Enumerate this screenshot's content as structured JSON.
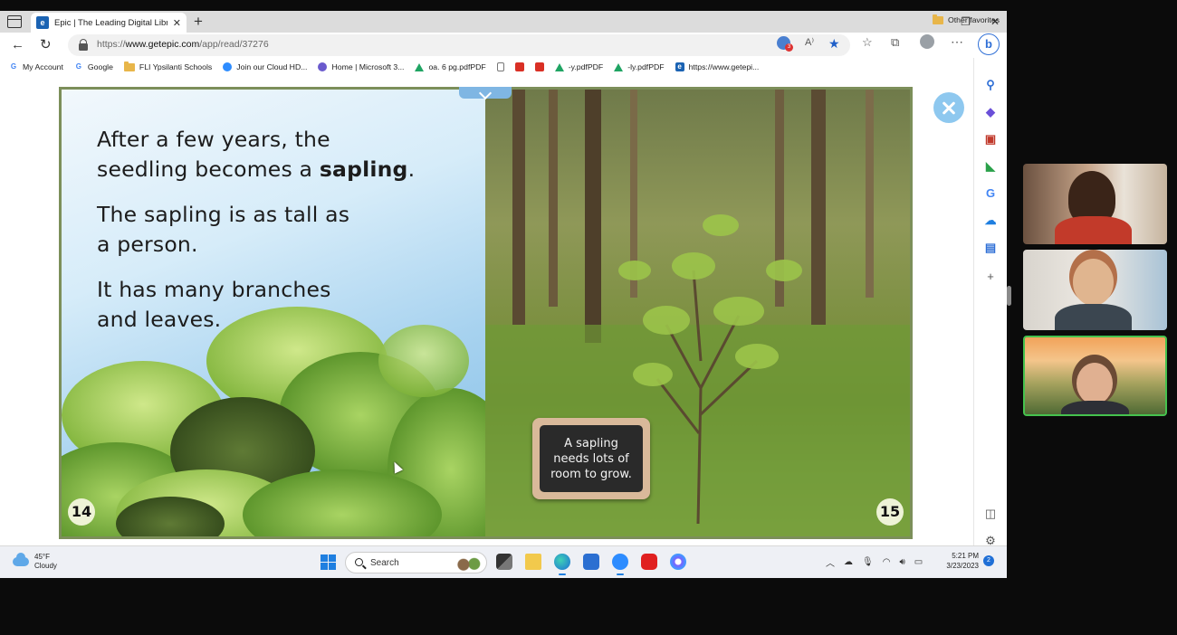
{
  "browser": {
    "tab": {
      "title": "Epic | The Leading Digital Library",
      "favicon_text": "e"
    },
    "new_tab_symbol": "+",
    "window_controls": {
      "minimize": "–",
      "restore": "❐",
      "close": "✕"
    },
    "url": {
      "prefix": "https://",
      "host": "www.getepic.com",
      "path": "/app/read/37276"
    },
    "tracker_count": "3",
    "bing_label": "b",
    "favorites": [
      {
        "label": "My Account",
        "icon": "google-icon",
        "glyph": "G",
        "color": "#4285f4"
      },
      {
        "label": "Google",
        "icon": "google-icon",
        "glyph": "G",
        "color": "#4285f4"
      },
      {
        "label": "FLI Ypsilanti Schools",
        "icon": "folder-icon",
        "glyph": "",
        "color": "#e8b64a"
      },
      {
        "label": "Join our Cloud HD...",
        "icon": "zoom-icon",
        "glyph": "",
        "color": "#2d8cff"
      },
      {
        "label": "Home | Microsoft 3...",
        "icon": "microsoft-icon",
        "glyph": "",
        "color": "#6a5acd"
      },
      {
        "label": "oa. 6 pg.pdfPDF",
        "icon": "drive-icon",
        "glyph": "",
        "color": "#1fa463"
      },
      {
        "label": "",
        "icon": "file-icon",
        "glyph": "",
        "color": "#777777"
      },
      {
        "label": "",
        "icon": "pdf-icon",
        "glyph": "",
        "color": "#d93025"
      },
      {
        "label": "",
        "icon": "pdf-icon",
        "glyph": "",
        "color": "#d93025"
      },
      {
        "label": "-y.pdfPDF",
        "icon": "drive-icon",
        "glyph": "",
        "color": "#1fa463"
      },
      {
        "label": "-ly.pdfPDF",
        "icon": "drive-icon",
        "glyph": "",
        "color": "#1fa463"
      },
      {
        "label": "https://www.getepi...",
        "icon": "epic-icon",
        "glyph": "e",
        "color": "#1b63b3"
      }
    ],
    "other_favorites": "Other favorites"
  },
  "book": {
    "left_page": {
      "paragraph_1_start": "After a few years, the\nseedling becomes a ",
      "paragraph_1_bold": "sapling",
      "paragraph_1_end": ".",
      "paragraph_2": "The sapling is as tall as\na person.",
      "paragraph_3": "It has many branches\nand leaves.",
      "page_number": "14"
    },
    "right_page": {
      "sign_text": "A sapling\nneeds lots of\nroom to grow.",
      "page_number": "15"
    }
  },
  "taskbar": {
    "weather_temp": "45°F",
    "weather_desc": "Cloudy",
    "search_label": "Search",
    "time": "5:21 PM",
    "date": "3/23/2023",
    "notification_count": "2"
  }
}
